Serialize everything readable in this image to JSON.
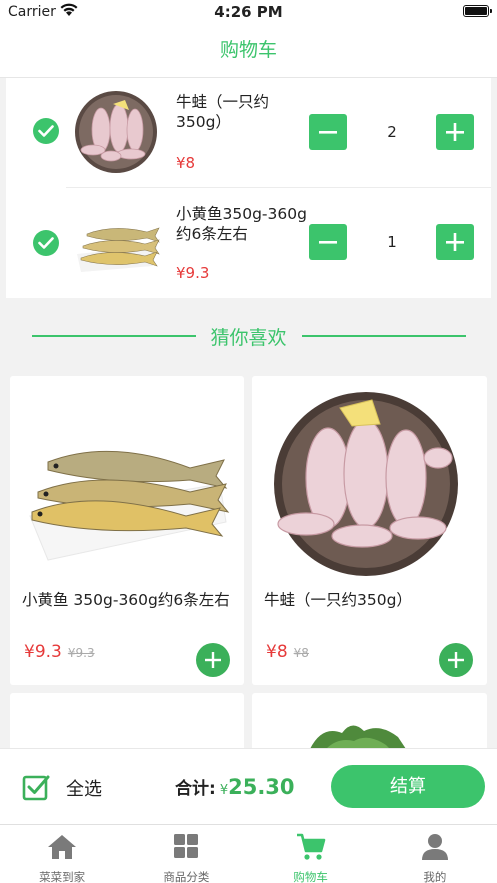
{
  "status": {
    "carrier": "Carrier",
    "time": "4:26 PM"
  },
  "nav": {
    "title": "购物车"
  },
  "cart": {
    "items": [
      {
        "name": "牛蛙（一只约350g）",
        "price": "¥8",
        "qty": "2",
        "checked": true
      },
      {
        "name": "小黄鱼350g-360g约6条左右",
        "price": "¥9.3",
        "qty": "1",
        "checked": true
      }
    ]
  },
  "guess": {
    "title": "猜你喜欢",
    "products": [
      {
        "name": "小黄鱼 350g-360g约6条左右",
        "price": "¥9.3",
        "old_price": "¥9.3"
      },
      {
        "name": "牛蛙（一只约350g）",
        "price": "¥8",
        "old_price": "¥8"
      }
    ]
  },
  "bottom": {
    "select_all": "全选",
    "total_label": "合计:",
    "currency": "¥",
    "total_amount": "25.30",
    "checkout": "结算"
  },
  "tabs": [
    {
      "label": "菜菜到家",
      "icon": "home-icon",
      "active": false
    },
    {
      "label": "商品分类",
      "icon": "grid-icon",
      "active": false
    },
    {
      "label": "购物车",
      "icon": "cart-icon",
      "active": true
    },
    {
      "label": "我的",
      "icon": "person-icon",
      "active": false
    }
  ],
  "colors": {
    "accent": "#3cc46c",
    "price": "#e63a3a",
    "background": "#f2f2f2"
  }
}
